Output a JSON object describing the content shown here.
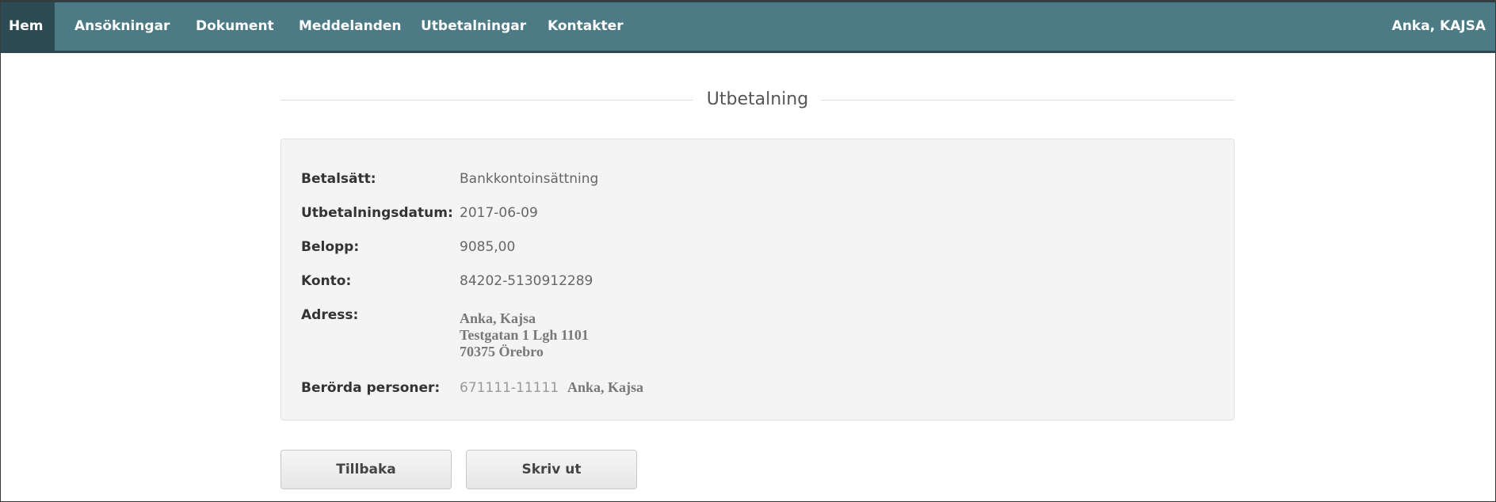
{
  "nav": {
    "items": [
      "Hem",
      "Ansökningar",
      "Dokument",
      "Meddelanden",
      "Utbetalningar",
      "Kontakter"
    ],
    "user": "Anka, KAJSA"
  },
  "section": {
    "title": "Utbetalning"
  },
  "details": {
    "payment_method_label": "Betalsätt:",
    "payment_method": "Bankkontoinsättning",
    "date_label": "Utbetalningsdatum:",
    "date": "2017-06-09",
    "amount_label": "Belopp:",
    "amount": "9085,00",
    "account_label": "Konto:",
    "account": "84202-5130912289",
    "address_label": "Adress:",
    "address_line1": "Anka, Kajsa",
    "address_line2": "Testgatan 1 Lgh 1101",
    "address_line3": "70375 Örebro",
    "persons_label": "Berörda personer:",
    "persons_id": "671111-11111",
    "persons_name": "Anka, Kajsa"
  },
  "buttons": {
    "back": "Tillbaka",
    "print": "Skriv ut"
  },
  "colors": {
    "navbar": "#4c7a85",
    "nav_active": "#2e4a52",
    "panel": "#f4f4f4"
  }
}
